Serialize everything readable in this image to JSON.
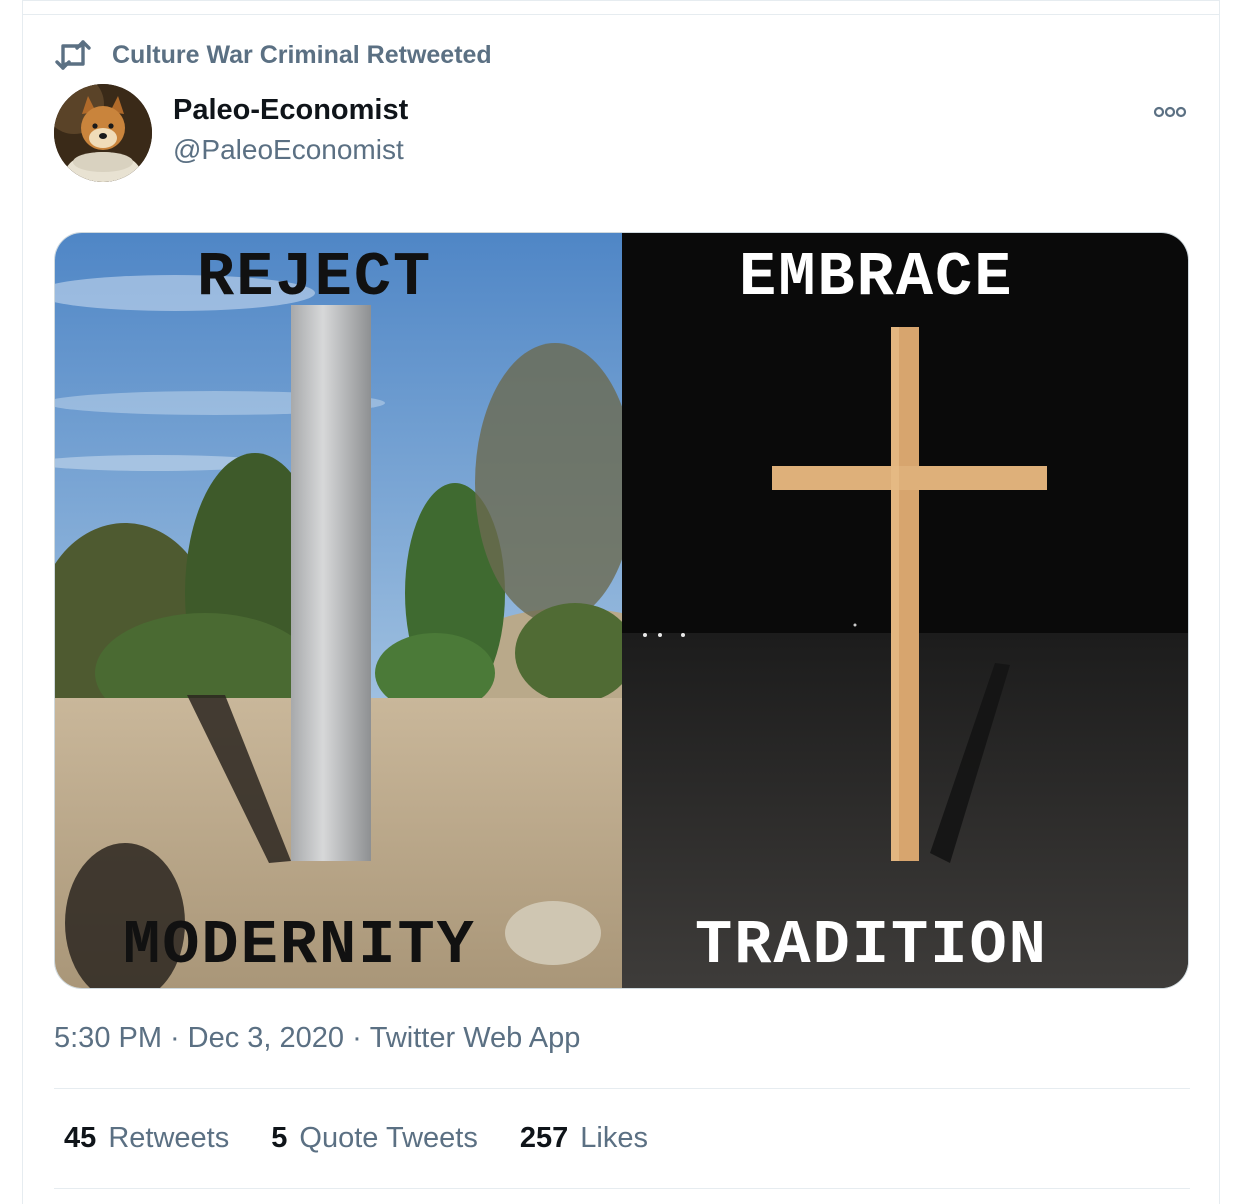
{
  "retweet_context": {
    "text": "Culture War Criminal Retweeted"
  },
  "author": {
    "name": "Paleo-Economist",
    "handle": "@PaleoEconomist"
  },
  "media": {
    "left_top": "REJECT",
    "left_bottom": "MODERNITY",
    "right_top": "EMBRACE",
    "right_bottom": "TRADITION"
  },
  "meta": {
    "time": "5:30 PM",
    "date": "Dec 3, 2020",
    "source": "Twitter Web App",
    "separator": "·"
  },
  "stats": [
    {
      "count": "45",
      "label": "Retweets"
    },
    {
      "count": "5",
      "label": "Quote Tweets"
    },
    {
      "count": "257",
      "label": "Likes"
    }
  ],
  "icons": {
    "retweet": "retweet-icon",
    "more": "more-options-icon"
  }
}
